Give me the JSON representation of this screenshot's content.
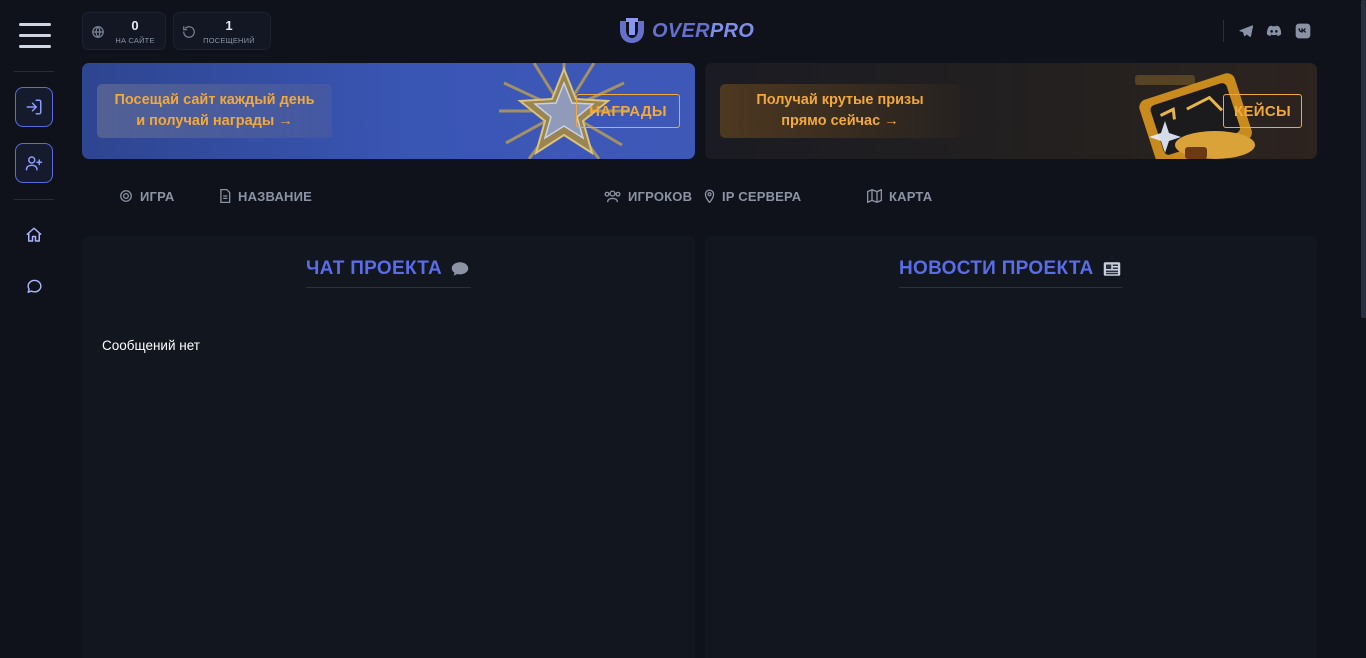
{
  "header": {
    "stats": [
      {
        "value": "0",
        "label": "НА САЙТЕ",
        "icon": "globe-icon"
      },
      {
        "value": "1",
        "label": "ПОСЕЩЕНИЙ",
        "icon": "refresh-icon"
      }
    ],
    "logo": {
      "part1": "OVER",
      "part2": "PRO"
    },
    "social": [
      "telegram-icon",
      "discord-icon",
      "vk-icon"
    ]
  },
  "sidebar": {
    "items": [
      {
        "name": "login-icon"
      },
      {
        "name": "register-icon"
      },
      {
        "name": "home-icon"
      },
      {
        "name": "chat-icon"
      }
    ]
  },
  "banners": [
    {
      "line1": "Посещай сайт каждый день",
      "line2": "и получай награды →",
      "cta": "НАГРАДЫ"
    },
    {
      "line1": "Получай крутые призы",
      "line2": "прямо сейчас →",
      "cta": "КЕЙСЫ"
    }
  ],
  "columns": {
    "game": "ИГРА",
    "name": "НАЗВАНИЕ",
    "players": "ИГРОКОВ",
    "ip": "IP СЕРВЕРА",
    "map": "КАРТА"
  },
  "chat": {
    "title": "ЧАТ ПРОЕКТА",
    "empty": "Сообщений нет"
  },
  "news": {
    "title": "НОВОСТИ ПРОЕКТА"
  },
  "colors": {
    "accent": "#5a6ce8",
    "orange": "#f2a93b",
    "background": "#0f121b",
    "panel": "#12161f"
  }
}
